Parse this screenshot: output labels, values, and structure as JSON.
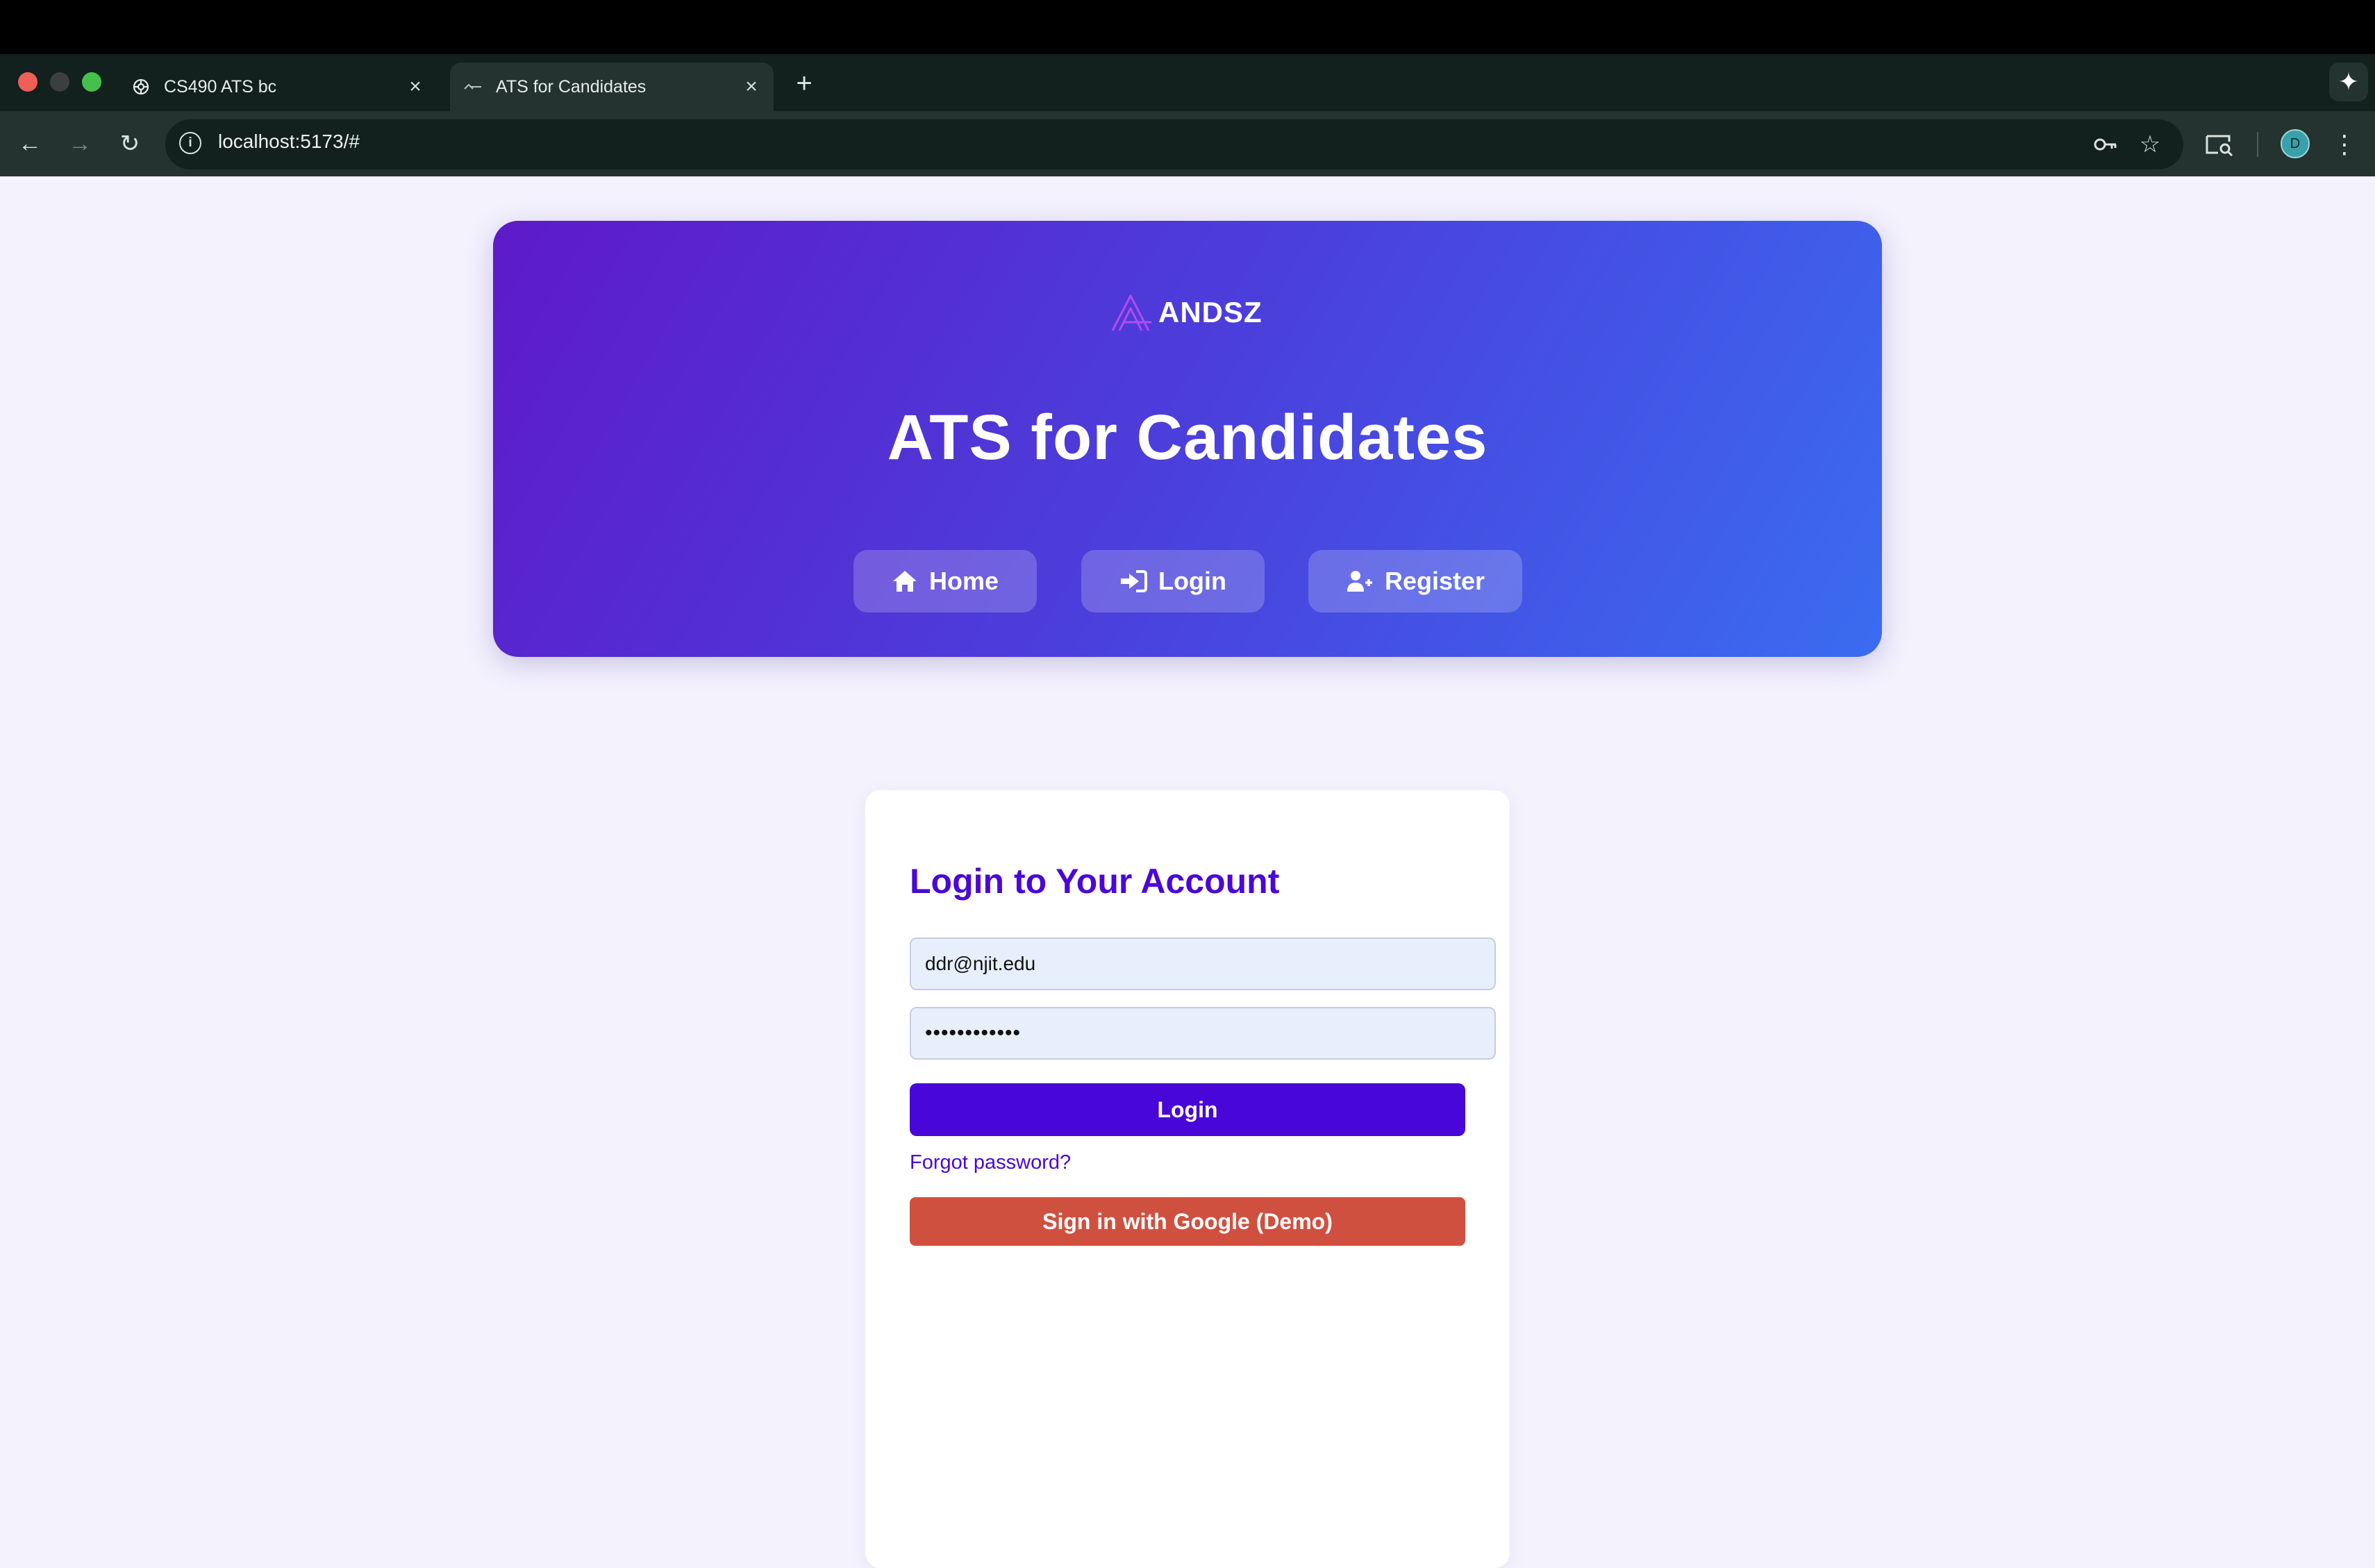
{
  "browser": {
    "tabs": [
      {
        "title": "CS490 ATS bc",
        "favicon": "openai-icon",
        "active": false
      },
      {
        "title": "ATS for Candidates",
        "favicon": "andsz-icon",
        "active": true
      }
    ],
    "new_tab_label": "+",
    "url": "localhost:5173/#",
    "profile_initial": "D"
  },
  "header": {
    "logo_text": "ANDSZ",
    "title": "ATS for Candidates",
    "nav": [
      {
        "label": "Home",
        "icon": "home-icon"
      },
      {
        "label": "Login",
        "icon": "sign-in-icon"
      },
      {
        "label": "Register",
        "icon": "user-plus-icon"
      }
    ]
  },
  "login": {
    "title": "Login to Your Account",
    "email_value": "ddr@njit.edu",
    "password_value": "••••••••••••",
    "submit_label": "Login",
    "forgot_label": "Forgot password?",
    "google_label": "Sign in with Google (Demo)"
  },
  "colors": {
    "hero_gradient_start": "#5e1ac8",
    "hero_gradient_end": "#3a6cf0",
    "accent": "#4806d8",
    "google_button": "#d05040",
    "page_background": "#f4f2fd"
  }
}
